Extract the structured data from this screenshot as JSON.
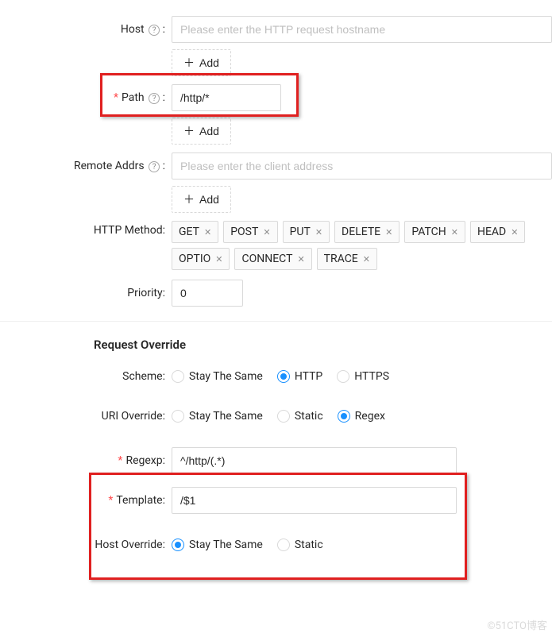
{
  "host": {
    "label": "Host",
    "placeholder": "Please enter the HTTP request hostname",
    "add": "Add"
  },
  "path": {
    "label": "Path",
    "value": "/http/*",
    "add": "Add"
  },
  "remote": {
    "label": "Remote Addrs",
    "placeholder": "Please enter the client address",
    "add": "Add"
  },
  "method": {
    "label": "HTTP Method:",
    "tags": [
      "GET",
      "POST",
      "PUT",
      "DELETE",
      "PATCH",
      "HEAD",
      "OPTIO",
      "CONNECT",
      "TRACE"
    ]
  },
  "priority": {
    "label": "Priority:",
    "value": "0"
  },
  "override": {
    "title": "Request Override",
    "scheme": {
      "label": "Scheme:",
      "options": [
        "Stay The Same",
        "HTTP",
        "HTTPS"
      ],
      "selected": 1
    },
    "uri": {
      "label": "URI Override:",
      "options": [
        "Stay The Same",
        "Static",
        "Regex"
      ],
      "selected": 2
    },
    "regexp": {
      "label": "Regexp:",
      "value": "^/http/(.*)"
    },
    "template": {
      "label": "Template:",
      "value": "/$1"
    },
    "host": {
      "label": "Host Override:",
      "options": [
        "Stay The Same",
        "Static"
      ],
      "selected": 0
    }
  },
  "watermark": "©51CTO博客"
}
